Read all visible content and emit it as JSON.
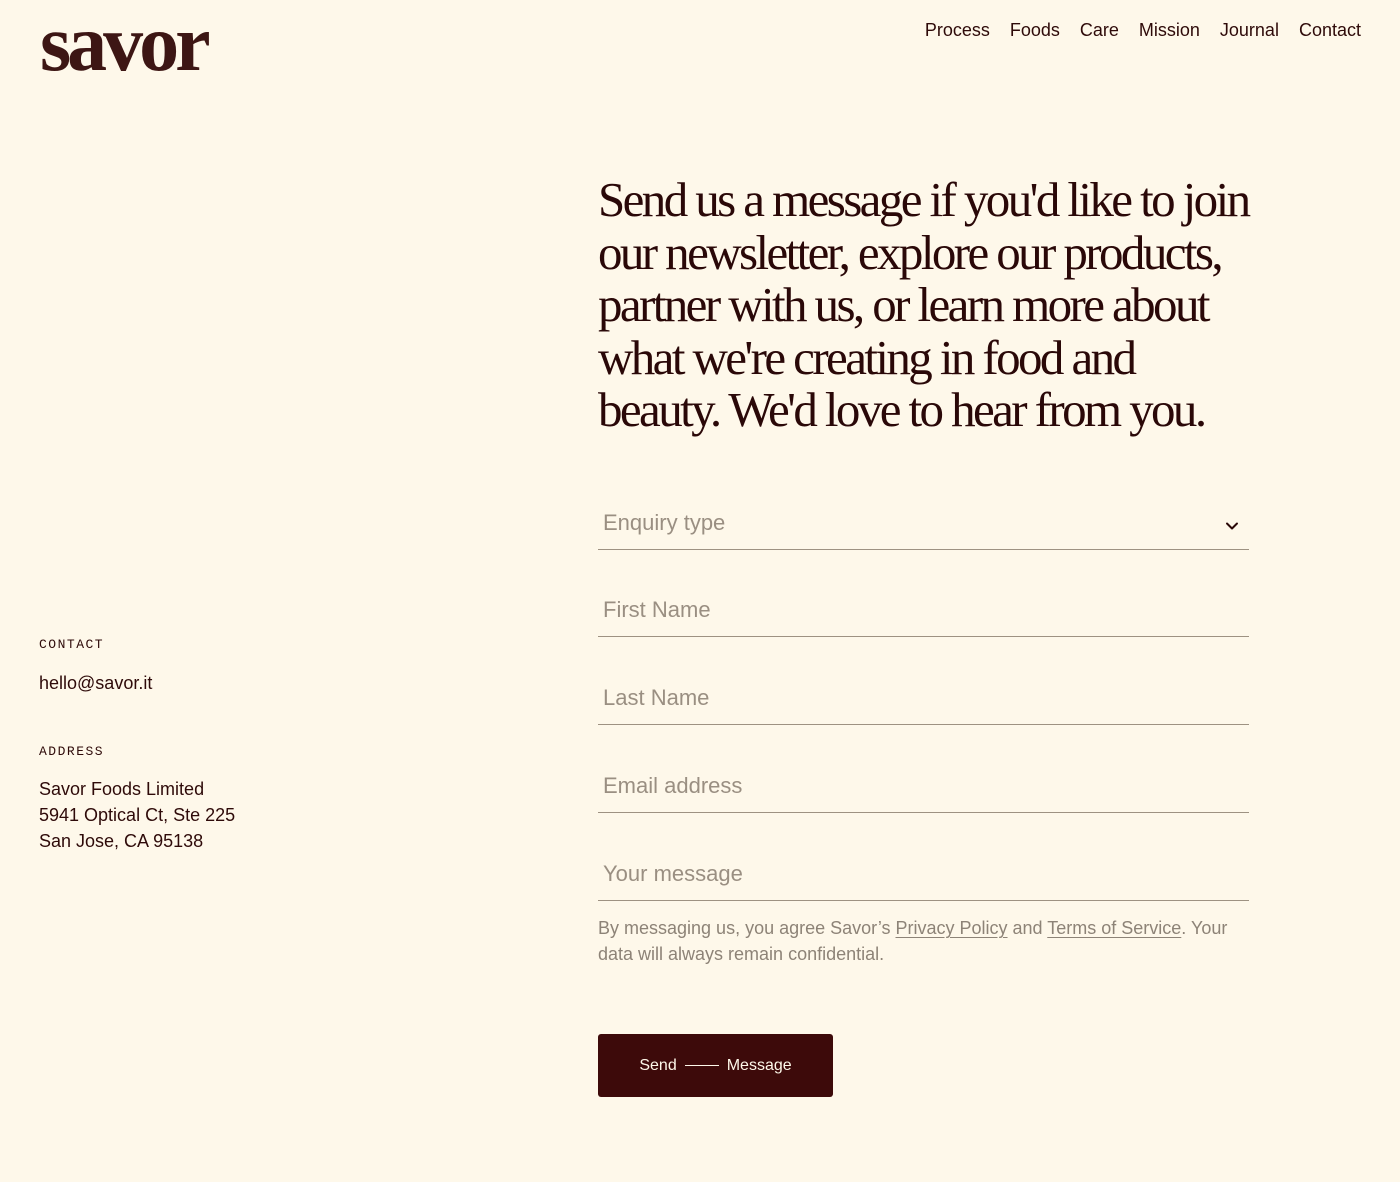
{
  "brand": {
    "logo_text": "savor"
  },
  "nav": {
    "items": [
      "Process",
      "Foods",
      "Care",
      "Mission",
      "Journal",
      "Contact"
    ]
  },
  "hero": {
    "headline": "Send us a message if you'd like to join our newsletter, explore our products, partner with us, or learn more about what we're creating in food and beauty. We'd love to hear from you."
  },
  "form": {
    "enquiry_placeholder": "Enquiry type",
    "first_name_placeholder": "First Name",
    "last_name_placeholder": "Last Name",
    "email_placeholder": "Email address",
    "message_placeholder": "Your message",
    "consent_prefix": "By messaging us, you agree Savor’s ",
    "privacy_link": "Privacy Policy",
    "consent_and": " and ",
    "terms_link": "Terms of Service",
    "consent_suffix": ". Your data will always remain confidential.",
    "submit_left": "Send",
    "submit_right": "Message"
  },
  "contact": {
    "label": "CONTACT",
    "email": "hello@savor.it"
  },
  "address": {
    "label": "ADDRESS",
    "lines": [
      "Savor Foods Limited",
      "5941 Optical Ct, Ste 225",
      "San Jose, CA 95138"
    ]
  },
  "colors": {
    "background": "#fef8ea",
    "brand": "#3d0a0a",
    "muted": "#9a8f82"
  }
}
